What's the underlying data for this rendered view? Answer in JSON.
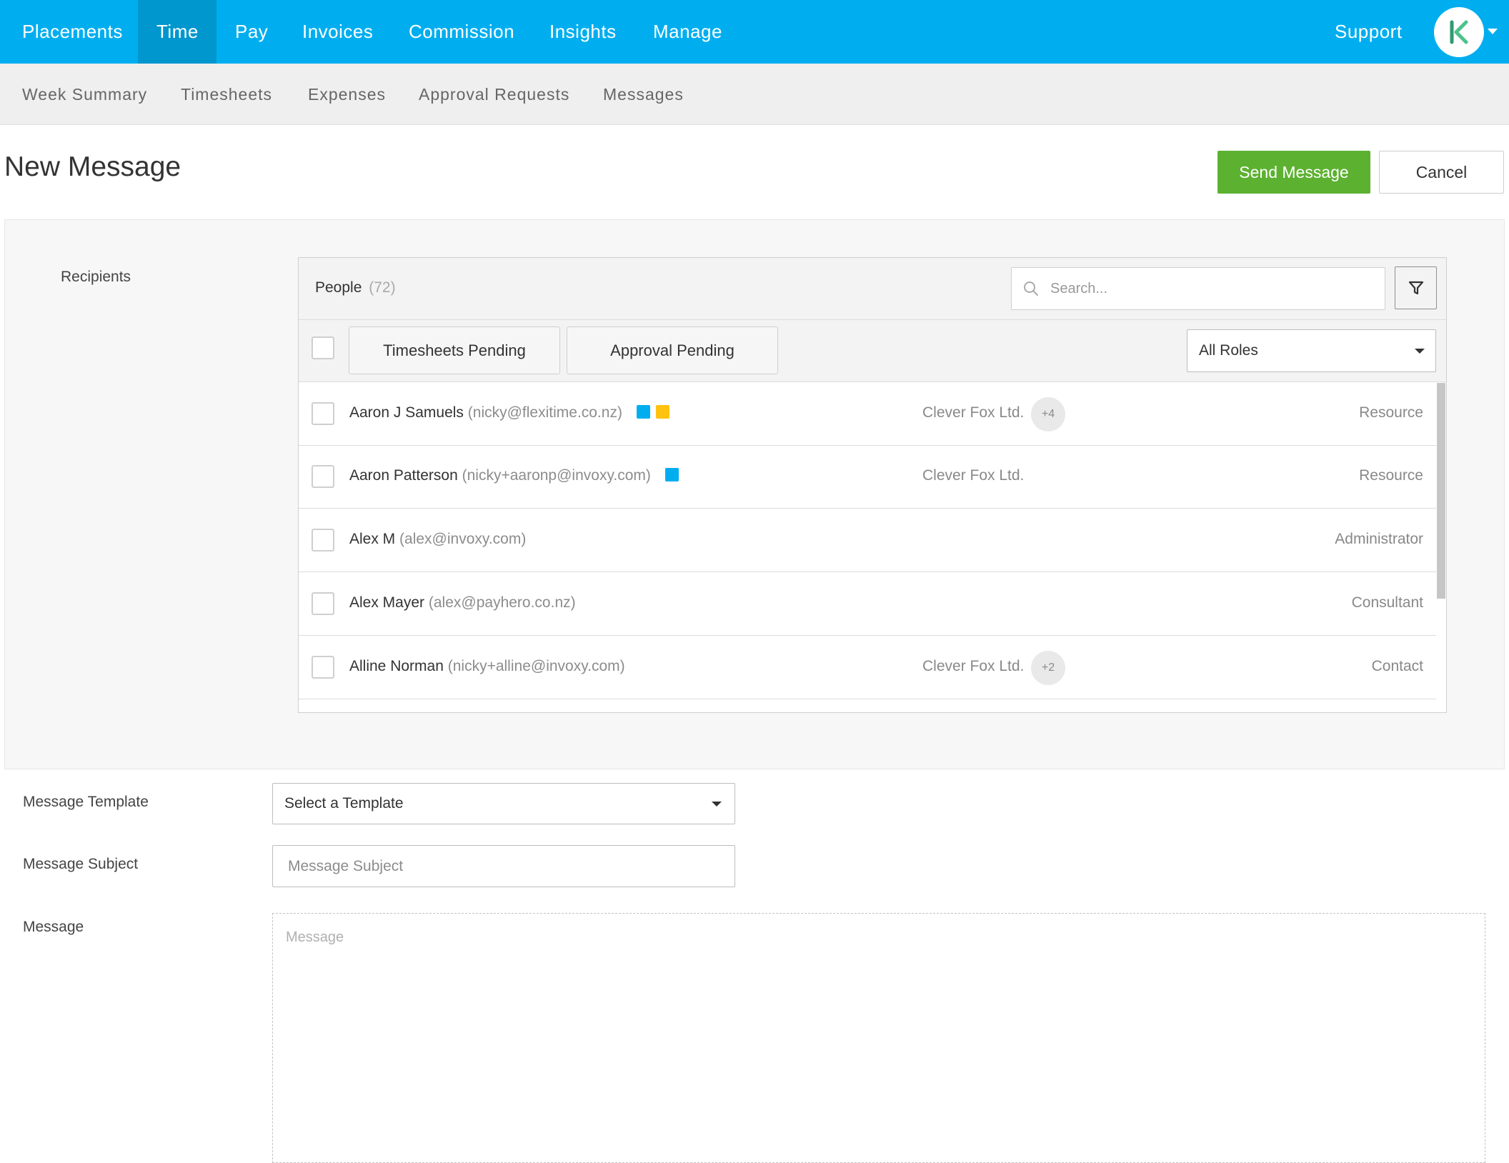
{
  "topnav": {
    "items": [
      {
        "label": "Placements",
        "active": false
      },
      {
        "label": "Time",
        "active": true
      },
      {
        "label": "Pay",
        "active": false
      },
      {
        "label": "Invoices",
        "active": false
      },
      {
        "label": "Commission",
        "active": false
      },
      {
        "label": "Insights",
        "active": false
      },
      {
        "label": "Manage",
        "active": false
      }
    ],
    "support_label": "Support",
    "avatar_icon": "k-logo-icon",
    "brand_color": "#00aeef",
    "active_color": "#0096ce"
  },
  "subnav": {
    "items": [
      {
        "label": "Week Summary"
      },
      {
        "label": "Timesheets"
      },
      {
        "label": "Expenses"
      },
      {
        "label": "Approval Requests"
      },
      {
        "label": "Messages"
      }
    ]
  },
  "page": {
    "title": "New Message",
    "send_label": "Send Message",
    "cancel_label": "Cancel",
    "send_color": "#5cb130"
  },
  "recipients": {
    "label": "Recipients",
    "people_title": "People",
    "people_count": "(72)",
    "search_placeholder": "Search...",
    "filter_timesheets": "Timesheets Pending",
    "filter_approval": "Approval Pending",
    "role_filter_value": "All Roles",
    "people": [
      {
        "name": "Aaron J Samuels",
        "email": "(nicky@flexitime.co.nz)",
        "tags": [
          "#00aeef",
          "#ffc20e"
        ],
        "company": "Clever Fox Ltd.",
        "more": "+4",
        "role": "Resource"
      },
      {
        "name": "Aaron Patterson",
        "email": "(nicky+aaronp@invoxy.com)",
        "tags": [
          "#00aeef"
        ],
        "company": "Clever Fox Ltd.",
        "more": "",
        "role": "Resource"
      },
      {
        "name": "Alex M",
        "email": "(alex@invoxy.com)",
        "tags": [],
        "company": "",
        "more": "",
        "role": "Administrator"
      },
      {
        "name": "Alex Mayer",
        "email": "(alex@payhero.co.nz)",
        "tags": [],
        "company": "",
        "more": "",
        "role": "Consultant"
      },
      {
        "name": "Alline Norman",
        "email": "(nicky+alline@invoxy.com)",
        "tags": [],
        "company": "Clever Fox Ltd.",
        "more": "+2",
        "role": "Contact"
      }
    ]
  },
  "form": {
    "template_label": "Message Template",
    "template_value": "Select a Template",
    "subject_label": "Message Subject",
    "subject_placeholder": "Message Subject",
    "message_label": "Message",
    "message_placeholder": "Message"
  }
}
